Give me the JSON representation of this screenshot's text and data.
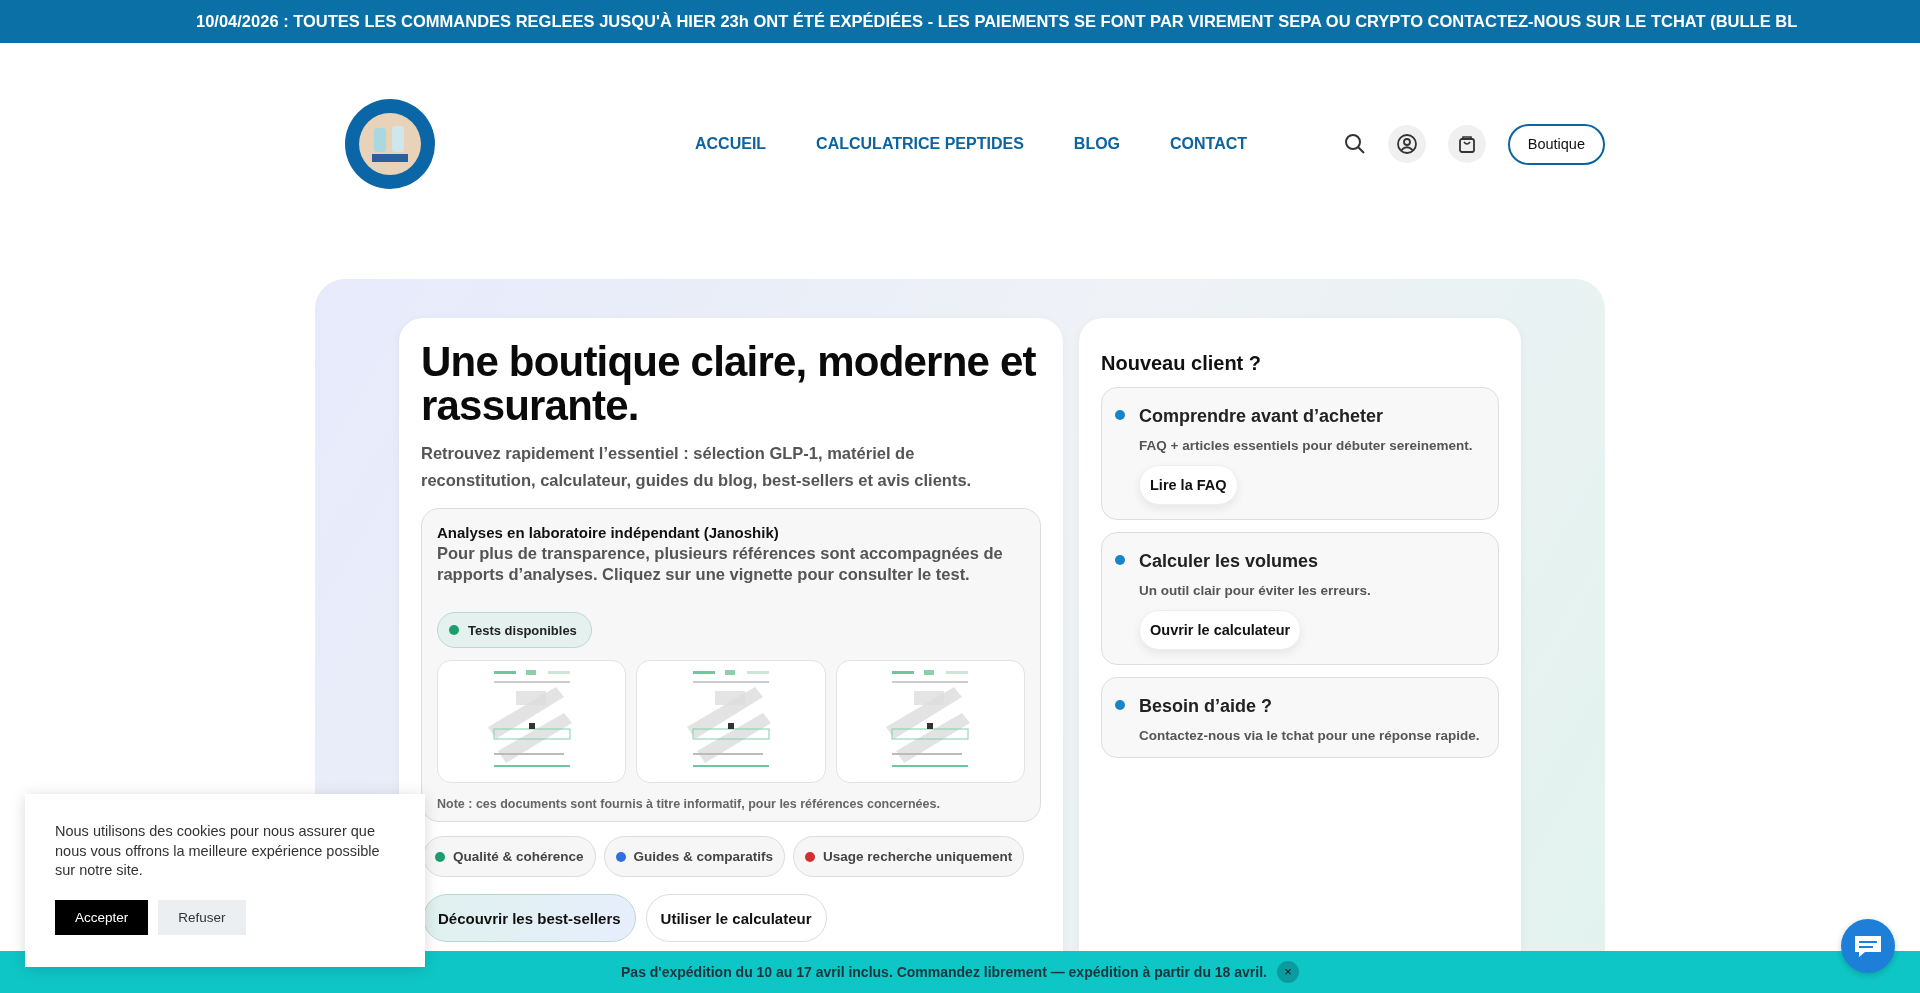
{
  "announcement_bar": {
    "text": "10/04/2026 : TOUTES LES COMMANDES REGLEES JUSQU'À HIER 23h ONT ÉTÉ EXPÉDIÉES - LES PAIEMENTS SE FONT PAR VIREMENT SEPA OU CRYPTO CONTACTEZ-NOUS SUR LE TCHAT (BULLE BL"
  },
  "header": {
    "nav": [
      {
        "label": "ACCUEIL"
      },
      {
        "label": "CALCULATRICE PEPTIDES"
      },
      {
        "label": "BLOG"
      },
      {
        "label": "CONTACT"
      }
    ],
    "shop_button": "Boutique"
  },
  "hero": {
    "left": {
      "title": "Une boutique claire, moderne et rassurante.",
      "subtitle": "Retrouvez rapidement l’essentiel : sélection GLP-1, matériel de reconstitution, calculateur, guides du blog, best-sellers et avis clients.",
      "lab_box": {
        "title": "Analyses en laboratoire indépendant (Janoshik)",
        "description": "Pour plus de transparence, plusieurs références sont accompagnées de rapports d’analyses. Cliquez sur une vignette pour consulter le test.",
        "badge": {
          "label": "Tests disponibles",
          "color": "#1a9e6e"
        },
        "note": "Note : ces documents sont fournis à titre informatif, pour les références concernées."
      },
      "chips": [
        {
          "label": "Qualité & cohérence",
          "color": "#1a9e6e"
        },
        {
          "label": "Guides & comparatifs",
          "color": "#2f6fe0"
        },
        {
          "label": "Usage recherche uniquement",
          "color": "#d32f2f"
        }
      ],
      "buttons": [
        {
          "label": "Découvrir les best-sellers",
          "kind": "primary"
        },
        {
          "label": "Utiliser le calculateur",
          "kind": "secondary"
        }
      ]
    },
    "right": {
      "title": "Nouveau client ?",
      "items": [
        {
          "title": "Comprendre avant d’acheter",
          "description": "FAQ + articles essentiels pour débuter sereinement.",
          "button": "Lire la FAQ"
        },
        {
          "title": "Calculer les volumes",
          "description": "Un outil clair pour éviter les erreurs.",
          "button": "Ouvrir le calculateur"
        },
        {
          "title": "Besoin d’aide ?",
          "description": "Contactez-nous via le tchat pour une réponse rapide."
        }
      ]
    }
  },
  "cookie_banner": {
    "text": "Nous utilisons des cookies pour nous assurer que nous vous offrons la meilleure expérience possible sur notre site.",
    "buttons": [
      {
        "label": "Accepter",
        "kind": "primary"
      },
      {
        "label": "Refuser",
        "kind": "secondary"
      }
    ]
  },
  "notice_bar": {
    "text": "Pas d'expédition du 10 au 17 avril inclus. Commandez librement — expédition à partir du 18 avril.",
    "close": "×"
  }
}
